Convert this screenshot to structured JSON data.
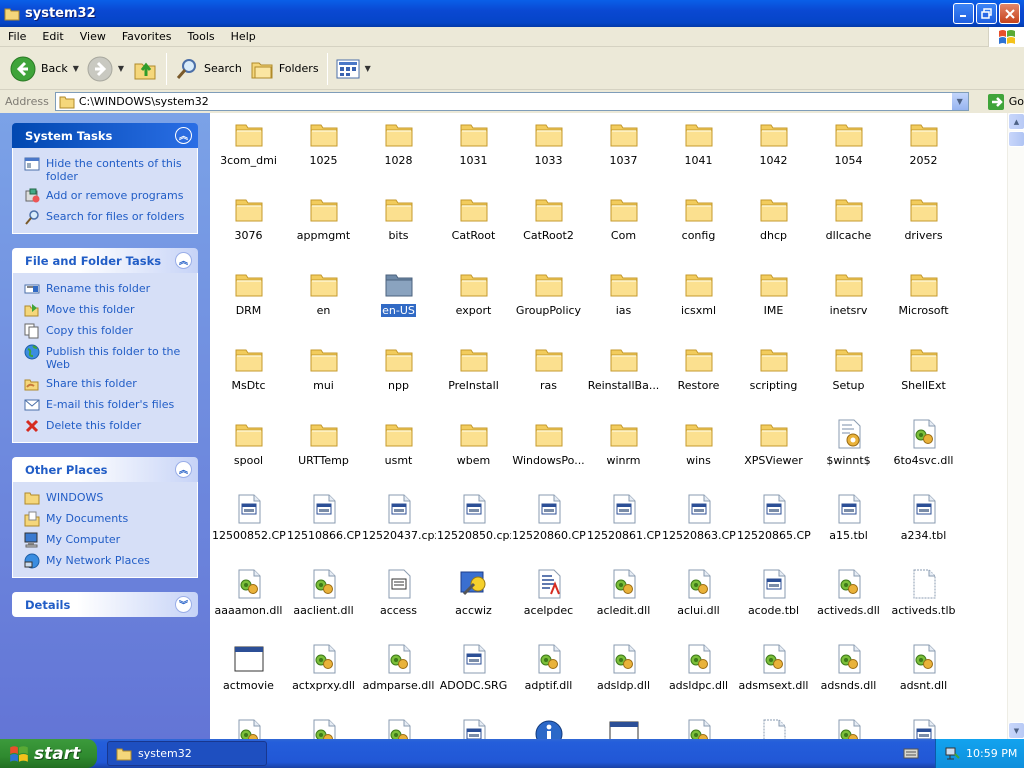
{
  "window": {
    "title": "system32"
  },
  "menu": [
    "File",
    "Edit",
    "View",
    "Favorites",
    "Tools",
    "Help"
  ],
  "toolbar": {
    "back": "Back",
    "search": "Search",
    "folders": "Folders"
  },
  "address": {
    "label": "Address",
    "value": "C:\\WINDOWS\\system32",
    "go": "Go"
  },
  "panels": {
    "system_tasks": {
      "title": "System Tasks",
      "items": [
        {
          "label": "Hide the contents of this folder",
          "icon": "hide-contents-icon"
        },
        {
          "label": "Add or remove programs",
          "icon": "add-remove-icon"
        },
        {
          "label": "Search for files or folders",
          "icon": "search-icon"
        }
      ]
    },
    "file_folder_tasks": {
      "title": "File and Folder Tasks",
      "items": [
        {
          "label": "Rename this folder",
          "icon": "rename-icon"
        },
        {
          "label": "Move this folder",
          "icon": "move-icon"
        },
        {
          "label": "Copy this folder",
          "icon": "copy-icon"
        },
        {
          "label": "Publish this folder to the Web",
          "icon": "globe-icon"
        },
        {
          "label": "Share this folder",
          "icon": "share-icon"
        },
        {
          "label": "E-mail this folder's files",
          "icon": "email-icon"
        },
        {
          "label": "Delete this folder",
          "icon": "delete-icon"
        }
      ]
    },
    "other_places": {
      "title": "Other Places",
      "items": [
        {
          "label": "WINDOWS",
          "icon": "folder-icon"
        },
        {
          "label": "My Documents",
          "icon": "my-documents-icon"
        },
        {
          "label": "My Computer",
          "icon": "my-computer-icon"
        },
        {
          "label": "My Network Places",
          "icon": "network-icon"
        }
      ]
    },
    "details": {
      "title": "Details"
    }
  },
  "files": [
    {
      "name": "3com_dmi",
      "type": "folder"
    },
    {
      "name": "1025",
      "type": "folder"
    },
    {
      "name": "1028",
      "type": "folder"
    },
    {
      "name": "1031",
      "type": "folder"
    },
    {
      "name": "1033",
      "type": "folder"
    },
    {
      "name": "1037",
      "type": "folder"
    },
    {
      "name": "1041",
      "type": "folder"
    },
    {
      "name": "1042",
      "type": "folder"
    },
    {
      "name": "1054",
      "type": "folder"
    },
    {
      "name": "2052",
      "type": "folder"
    },
    {
      "name": "3076",
      "type": "folder"
    },
    {
      "name": "appmgmt",
      "type": "folder"
    },
    {
      "name": "bits",
      "type": "folder"
    },
    {
      "name": "CatRoot",
      "type": "folder"
    },
    {
      "name": "CatRoot2",
      "type": "folder"
    },
    {
      "name": "Com",
      "type": "folder"
    },
    {
      "name": "config",
      "type": "folder"
    },
    {
      "name": "dhcp",
      "type": "folder"
    },
    {
      "name": "dllcache",
      "type": "folder"
    },
    {
      "name": "drivers",
      "type": "folder"
    },
    {
      "name": "DRM",
      "type": "folder"
    },
    {
      "name": "en",
      "type": "folder"
    },
    {
      "name": "en-US",
      "type": "folder",
      "selected": true
    },
    {
      "name": "export",
      "type": "folder"
    },
    {
      "name": "GroupPolicy",
      "type": "folder"
    },
    {
      "name": "ias",
      "type": "folder"
    },
    {
      "name": "icsxml",
      "type": "folder"
    },
    {
      "name": "IME",
      "type": "folder"
    },
    {
      "name": "inetsrv",
      "type": "folder"
    },
    {
      "name": "Microsoft",
      "type": "folder"
    },
    {
      "name": "MsDtc",
      "type": "folder"
    },
    {
      "name": "mui",
      "type": "folder"
    },
    {
      "name": "npp",
      "type": "folder"
    },
    {
      "name": "PreInstall",
      "type": "folder"
    },
    {
      "name": "ras",
      "type": "folder"
    },
    {
      "name": "ReinstallBa...",
      "type": "folder"
    },
    {
      "name": "Restore",
      "type": "folder"
    },
    {
      "name": "scripting",
      "type": "folder"
    },
    {
      "name": "Setup",
      "type": "folder"
    },
    {
      "name": "ShellExt",
      "type": "folder"
    },
    {
      "name": "spool",
      "type": "folder"
    },
    {
      "name": "URTTemp",
      "type": "folder"
    },
    {
      "name": "usmt",
      "type": "folder"
    },
    {
      "name": "wbem",
      "type": "folder"
    },
    {
      "name": "WindowsPo...",
      "type": "folder"
    },
    {
      "name": "winrm",
      "type": "folder"
    },
    {
      "name": "wins",
      "type": "folder"
    },
    {
      "name": "XPSViewer",
      "type": "folder"
    },
    {
      "name": "$winnt$",
      "type": "settings"
    },
    {
      "name": "6to4svc.dll",
      "type": "dll"
    },
    {
      "name": "12500852.CPX",
      "type": "app"
    },
    {
      "name": "12510866.CPX",
      "type": "app"
    },
    {
      "name": "12520437.cpx",
      "type": "app"
    },
    {
      "name": "12520850.cpx",
      "type": "app"
    },
    {
      "name": "12520860.CPX",
      "type": "app"
    },
    {
      "name": "12520861.CPX",
      "type": "app"
    },
    {
      "name": "12520863.CPX",
      "type": "app"
    },
    {
      "name": "12520865.CPX",
      "type": "app"
    },
    {
      "name": "a15.tbl",
      "type": "app"
    },
    {
      "name": "a234.tbl",
      "type": "app"
    },
    {
      "name": "aaaamon.dll",
      "type": "dll"
    },
    {
      "name": "aaclient.dll",
      "type": "dll"
    },
    {
      "name": "access",
      "type": "cpl"
    },
    {
      "name": "accwiz",
      "type": "wizard"
    },
    {
      "name": "acelpdec",
      "type": "codec"
    },
    {
      "name": "acledit.dll",
      "type": "dll"
    },
    {
      "name": "aclui.dll",
      "type": "dll"
    },
    {
      "name": "acode.tbl",
      "type": "app"
    },
    {
      "name": "activeds.dll",
      "type": "dll"
    },
    {
      "name": "activeds.tlb",
      "type": "tlb"
    },
    {
      "name": "actmovie",
      "type": "window"
    },
    {
      "name": "actxprxy.dll",
      "type": "dll"
    },
    {
      "name": "admparse.dll",
      "type": "dll"
    },
    {
      "name": "ADODC.SRG",
      "type": "app"
    },
    {
      "name": "adptif.dll",
      "type": "dll"
    },
    {
      "name": "adsldp.dll",
      "type": "dll"
    },
    {
      "name": "adsldpc.dll",
      "type": "dll"
    },
    {
      "name": "adsmsext.dll",
      "type": "dll"
    },
    {
      "name": "adsnds.dll",
      "type": "dll"
    },
    {
      "name": "adsnt.dll",
      "type": "dll"
    },
    {
      "name": "",
      "type": "dll"
    },
    {
      "name": "",
      "type": "dll"
    },
    {
      "name": "",
      "type": "dll"
    },
    {
      "name": "",
      "type": "app"
    },
    {
      "name": "",
      "type": "info"
    },
    {
      "name": "",
      "type": "window"
    },
    {
      "name": "",
      "type": "dll"
    },
    {
      "name": "",
      "type": "tlb"
    },
    {
      "name": "",
      "type": "dll"
    },
    {
      "name": "",
      "type": "app"
    }
  ],
  "taskbar": {
    "start": "start",
    "task": "system32",
    "clock": "10:59 PM"
  },
  "colors": {
    "title_bar": "#0a48d2",
    "task_pane": "#7ba2e7",
    "link": "#215dc6",
    "selection": "#316ac5",
    "start_button": "#2f8a2f"
  }
}
